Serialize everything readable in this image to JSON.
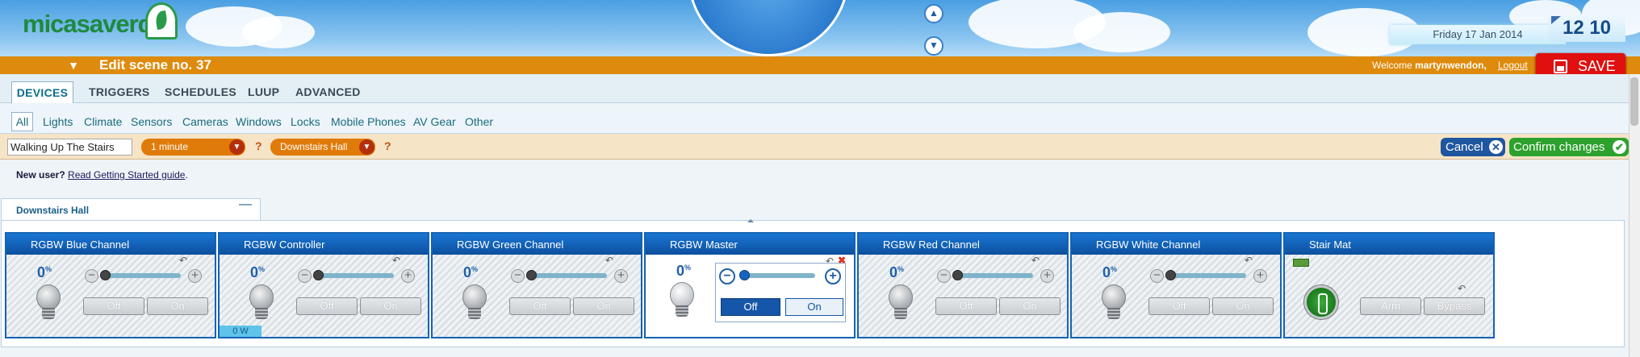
{
  "header": {
    "logo": "micasaverde",
    "date": "Friday 17 Jan 2014",
    "time": "12 10"
  },
  "scene_bar": {
    "title": "Edit scene no. 37",
    "welcome_prefix": "Welcome",
    "username": "martynwendon,",
    "logout": "Logout",
    "save": "SAVE"
  },
  "main_tabs": [
    "DEVICES",
    "TRIGGERS",
    "SCHEDULES",
    "LUUP",
    "ADVANCED"
  ],
  "sub_tabs": [
    "All",
    "Lights",
    "Climate",
    "Sensors",
    "Cameras",
    "Windows",
    "Locks",
    "Mobile Phones",
    "AV Gear",
    "Other"
  ],
  "filter": {
    "scene_name": "Walking Up The Stairs",
    "delay": "1 minute",
    "room": "Downstairs Hall",
    "help": "?",
    "cancel": "Cancel",
    "confirm": "Confirm changes"
  },
  "notice": {
    "prefix": "New user?",
    "link": "Read Getting Started guide",
    "suffix": "."
  },
  "room": {
    "name": "Downstairs Hall",
    "collapse": "—"
  },
  "devices": [
    {
      "name": "RGBW Blue Channel",
      "level": "0",
      "unit": "%",
      "off": "Off",
      "on": "On"
    },
    {
      "name": "RGBW Controller",
      "level": "0",
      "unit": "%",
      "off": "Off",
      "on": "On",
      "watts": "0 W"
    },
    {
      "name": "RGBW Green Channel",
      "level": "0",
      "unit": "%",
      "off": "Off",
      "on": "On"
    },
    {
      "name": "RGBW Master",
      "level": "0",
      "unit": "%",
      "off": "Off",
      "on": "On"
    },
    {
      "name": "RGBW Red Channel",
      "level": "0",
      "unit": "%",
      "off": "Off",
      "on": "On"
    },
    {
      "name": "RGBW White Channel",
      "level": "0",
      "unit": "%",
      "off": "Off",
      "on": "On"
    },
    {
      "name": "Stair Mat",
      "arm": "Arm",
      "bypass": "Bypass"
    }
  ],
  "colors": {
    "orange_bar": "#de8a0c",
    "save_red": "#e01010",
    "card_header": "#1462b5",
    "confirm_green": "#2da12d",
    "cancel_blue": "#1f56a0"
  }
}
